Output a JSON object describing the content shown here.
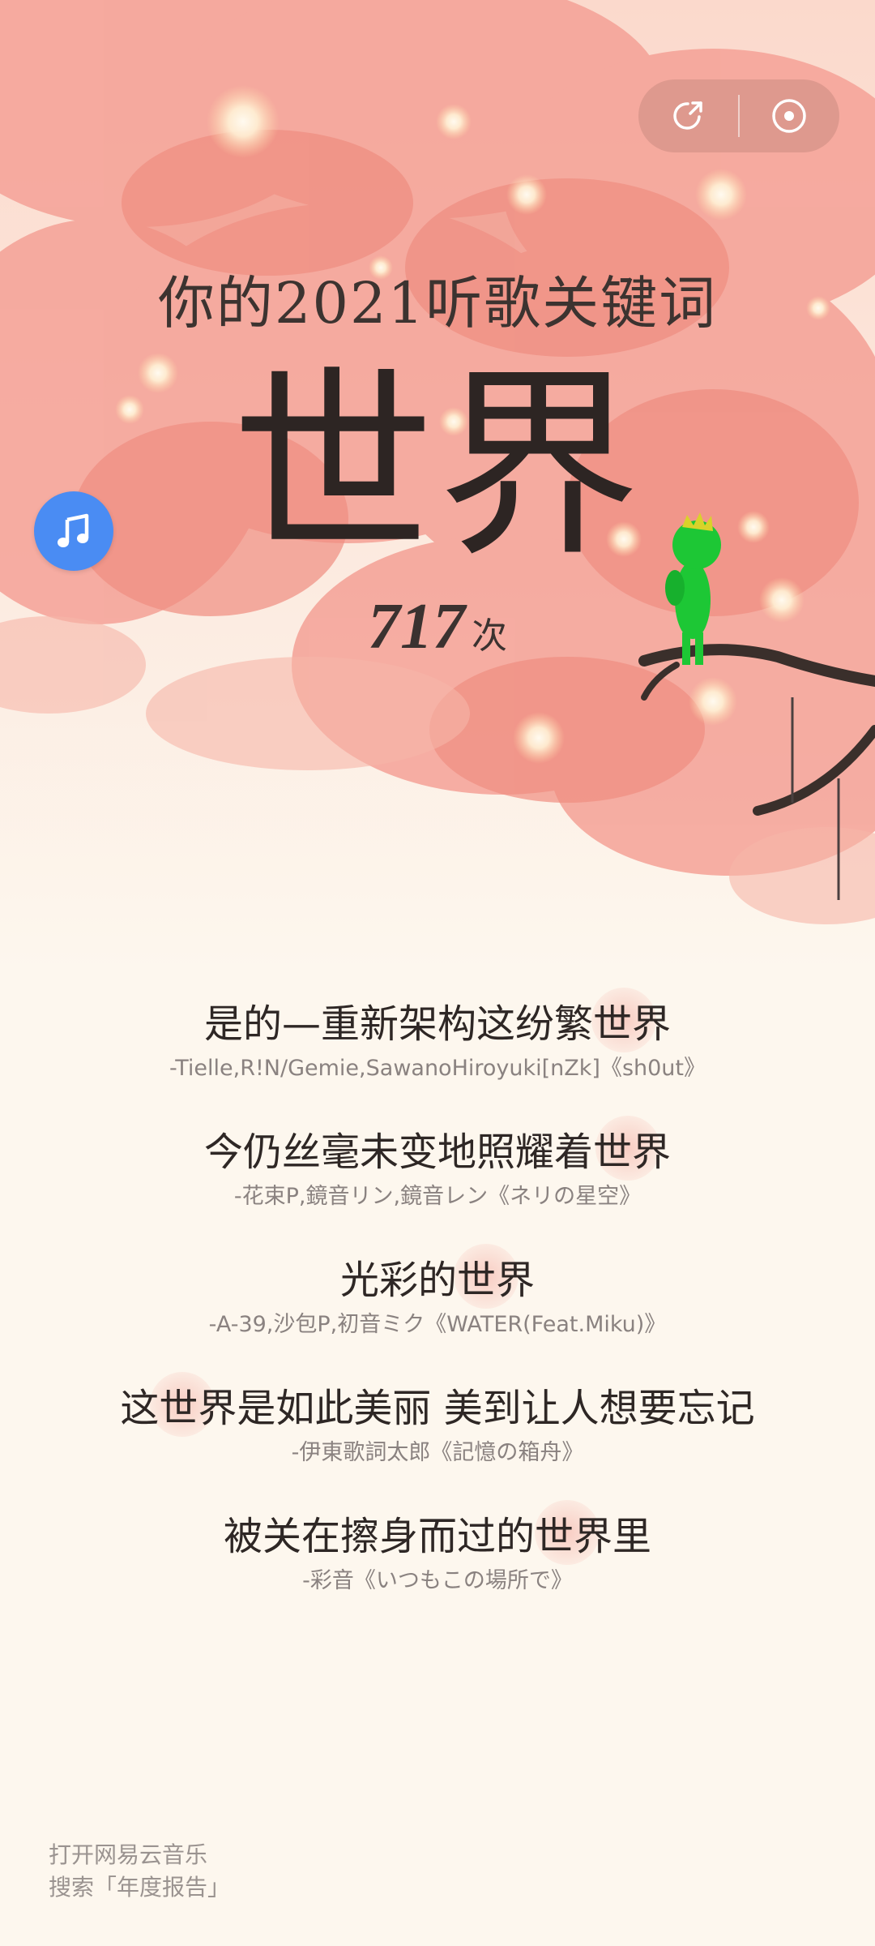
{
  "toolbar": {
    "share_icon": "share-arrow-icon",
    "target_icon": "record-target-icon"
  },
  "report": {
    "headline": "你的2021听歌关键词",
    "keyword": "世界",
    "count": "717",
    "count_unit": "次"
  },
  "music_button": {
    "icon": "music-note-icon"
  },
  "lyrics": [
    {
      "text": "是的—重新架构这纷繁世界",
      "source": "-Tielle,R!N/Gemie,SawanoHiroyuki[nZk]《sh0ut》"
    },
    {
      "text": "今仍丝毫未变地照耀着世界",
      "source": "-花束P,鏡音リン,鏡音レン《ネリの星空》"
    },
    {
      "text": "光彩的世界",
      "source": "-A-39,沙包P,初音ミク《WATER(Feat.Miku)》"
    },
    {
      "text": "这世界是如此美丽 美到让人想要忘记",
      "source": "-伊東歌詞太郎《記憶の箱舟》"
    },
    {
      "text": "被关在擦身而过的世界里",
      "source": "-彩音《いつもこの場所で》"
    }
  ],
  "footer": {
    "line1": "打开网易云音乐",
    "line2": "搜索「年度报告」"
  },
  "colors": {
    "music_button": "#4a8cf3",
    "background": "#fdf7ee",
    "blossom": "#f39a8c"
  }
}
